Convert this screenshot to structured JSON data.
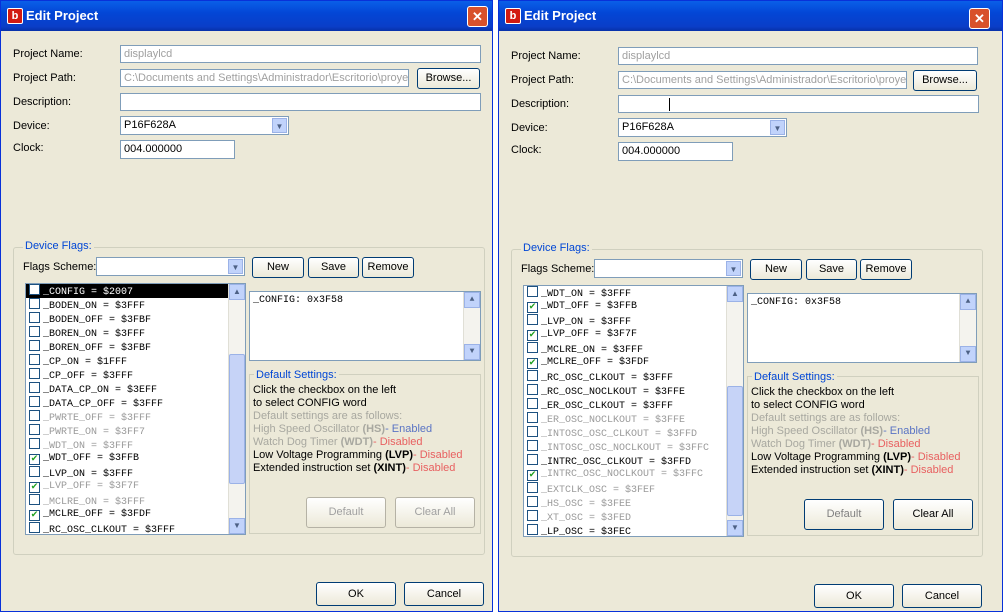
{
  "dialog_title": "Edit Project",
  "app_icon_letter": "b",
  "close_glyph": "✕",
  "labels": {
    "project_name": "Project Name:",
    "project_path": "Project Path:",
    "description": "Description:",
    "device": "Device:",
    "clock": "Clock:",
    "device_flags": "Device Flags:",
    "flags_scheme": "Flags Scheme:",
    "default_settings": "Default Settings:"
  },
  "values": {
    "project_name": "displaylcd",
    "project_path": "C:\\Documents and Settings\\Administrador\\Escritorio\\proyec",
    "description": "",
    "device": "P16F628A",
    "clock": "004.000000",
    "flags_scheme": "",
    "config_memo": "_CONFIG: 0x3F58"
  },
  "buttons": {
    "browse": "Browse...",
    "new": "New",
    "save": "Save",
    "remove": "Remove",
    "default": "Default",
    "clear_all": "Clear All",
    "ok": "OK",
    "cancel": "Cancel"
  },
  "default_settings": {
    "line1": "Click the checkbox on the left",
    "line2": "to select CONFIG word",
    "line3": "Default settings are as follows:",
    "items": [
      {
        "text": "High Speed Oscillator ",
        "code": "(HS)",
        "state": "- Enabled",
        "kind": "en"
      },
      {
        "text": "Watch Dog Timer ",
        "code": "(WDT)",
        "state": "- Disabled",
        "kind": "dis"
      },
      {
        "text": "Low Voltage Programming ",
        "code": "(LVP)",
        "state": "- Disabled",
        "kind": "dis"
      },
      {
        "text": "Extended instruction set ",
        "code": "(XINT)",
        "state": "- Disabled",
        "kind": "dis"
      }
    ]
  },
  "left_flags": [
    {
      "label": "_CONFIG = $2007",
      "checked": false,
      "selected": true,
      "dim": false
    },
    {
      "label": "_BODEN_ON = $3FFF",
      "checked": false,
      "selected": false,
      "dim": false
    },
    {
      "label": "_BODEN_OFF = $3FBF",
      "checked": false,
      "selected": false,
      "dim": false
    },
    {
      "label": "_BOREN_ON = $3FFF",
      "checked": false,
      "selected": false,
      "dim": false
    },
    {
      "label": "_BOREN_OFF = $3FBF",
      "checked": false,
      "selected": false,
      "dim": false
    },
    {
      "label": "_CP_ON = $1FFF",
      "checked": false,
      "selected": false,
      "dim": false
    },
    {
      "label": "_CP_OFF = $3FFF",
      "checked": false,
      "selected": false,
      "dim": false
    },
    {
      "label": "_DATA_CP_ON = $3EFF",
      "checked": false,
      "selected": false,
      "dim": false
    },
    {
      "label": "_DATA_CP_OFF = $3FFF",
      "checked": false,
      "selected": false,
      "dim": false
    },
    {
      "label": "_PWRTE_OFF = $3FFF",
      "checked": false,
      "selected": false,
      "dim": true
    },
    {
      "label": "_PWRTE_ON = $3FF7",
      "checked": false,
      "selected": false,
      "dim": true
    },
    {
      "label": "_WDT_ON = $3FFF",
      "checked": false,
      "selected": false,
      "dim": true
    },
    {
      "label": "_WDT_OFF = $3FFB",
      "checked": true,
      "selected": false,
      "dim": false
    },
    {
      "label": "_LVP_ON = $3FFF",
      "checked": false,
      "selected": false,
      "dim": false
    },
    {
      "label": "_LVP_OFF = $3F7F",
      "checked": true,
      "selected": false,
      "dim": true
    },
    {
      "label": "_MCLRE_ON = $3FFF",
      "checked": false,
      "selected": false,
      "dim": true
    },
    {
      "label": "_MCLRE_OFF = $3FDF",
      "checked": true,
      "selected": false,
      "dim": false
    },
    {
      "label": "_RC_OSC_CLKOUT = $3FFF",
      "checked": false,
      "selected": false,
      "dim": false
    }
  ],
  "right_flags": [
    {
      "label": "_WDT_ON = $3FFF",
      "checked": false,
      "selected": false,
      "dim": false
    },
    {
      "label": "_WDT_OFF = $3FFB",
      "checked": true,
      "selected": false,
      "dim": false
    },
    {
      "label": "_LVP_ON = $3FFF",
      "checked": false,
      "selected": false,
      "dim": false
    },
    {
      "label": "_LVP_OFF = $3F7F",
      "checked": true,
      "selected": false,
      "dim": false
    },
    {
      "label": "_MCLRE_ON = $3FFF",
      "checked": false,
      "selected": false,
      "dim": false
    },
    {
      "label": "_MCLRE_OFF = $3FDF",
      "checked": true,
      "selected": false,
      "dim": false
    },
    {
      "label": "_RC_OSC_CLKOUT = $3FFF",
      "checked": false,
      "selected": false,
      "dim": false
    },
    {
      "label": "_RC_OSC_NOCLKOUT = $3FFE",
      "checked": false,
      "selected": false,
      "dim": false
    },
    {
      "label": "_ER_OSC_CLKOUT = $3FFF",
      "checked": false,
      "selected": false,
      "dim": false
    },
    {
      "label": "_ER_OSC_NOCLKOUT = $3FFE",
      "checked": false,
      "selected": false,
      "dim": true
    },
    {
      "label": "_INTOSC_OSC_CLKOUT = $3FFD",
      "checked": false,
      "selected": false,
      "dim": true
    },
    {
      "label": "_INTOSC_OSC_NOCLKOUT = $3FFC",
      "checked": false,
      "selected": false,
      "dim": true
    },
    {
      "label": "_INTRC_OSC_CLKOUT = $3FFD",
      "checked": false,
      "selected": false,
      "dim": false
    },
    {
      "label": "_INTRC_OSC_NOCLKOUT = $3FFC",
      "checked": true,
      "selected": false,
      "dim": true
    },
    {
      "label": "_EXTCLK_OSC = $3FEF",
      "checked": false,
      "selected": false,
      "dim": true
    },
    {
      "label": "_HS_OSC = $3FEE",
      "checked": false,
      "selected": false,
      "dim": true
    },
    {
      "label": "_XT_OSC = $3FED",
      "checked": false,
      "selected": false,
      "dim": true
    },
    {
      "label": "_LP_OSC = $3FEC",
      "checked": false,
      "selected": false,
      "dim": false
    }
  ],
  "icons": {
    "arrow_down": "▼",
    "arrow_up": "▲",
    "check": "✔"
  }
}
